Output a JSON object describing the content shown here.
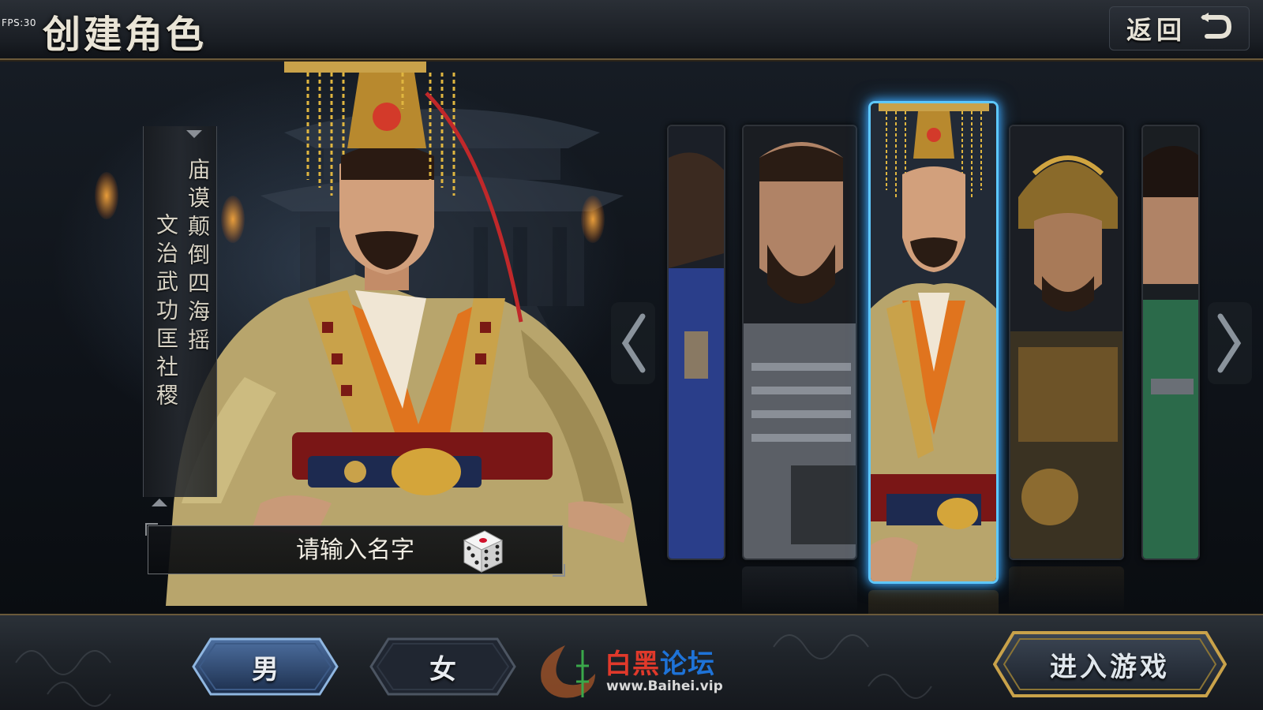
{
  "hud": {
    "fps": "FPS:30"
  },
  "header": {
    "title": "创建角色",
    "back_label": "返回"
  },
  "hero": {
    "motto_line_1": "庙谟颠倒四海摇",
    "motto_line_2": "文治武功匡社稷"
  },
  "name_field": {
    "placeholder": "请输入名字",
    "value": ""
  },
  "characters": [
    {
      "id": "char-1",
      "selected": false,
      "armor": "#2a3e8a"
    },
    {
      "id": "char-2",
      "selected": false,
      "armor": "#5b5f66"
    },
    {
      "id": "char-3",
      "selected": true,
      "armor": "#b0402a"
    },
    {
      "id": "char-4",
      "selected": false,
      "armor": "#7a5b2a"
    },
    {
      "id": "char-5",
      "selected": false,
      "armor": "#2b6a4a"
    }
  ],
  "gender": {
    "male_label": "男",
    "female_label": "女",
    "selected": "male"
  },
  "enter_label": "进入游戏",
  "watermark": {
    "cn_part1": "白黑",
    "cn_part2": "论坛",
    "url": "www.Baihei.vip"
  },
  "colors": {
    "selected_glow": "#5ec8ff",
    "gold_trim": "#c9a24a",
    "robe_orange": "#e0741e",
    "robe_cream": "#c8b98a"
  }
}
